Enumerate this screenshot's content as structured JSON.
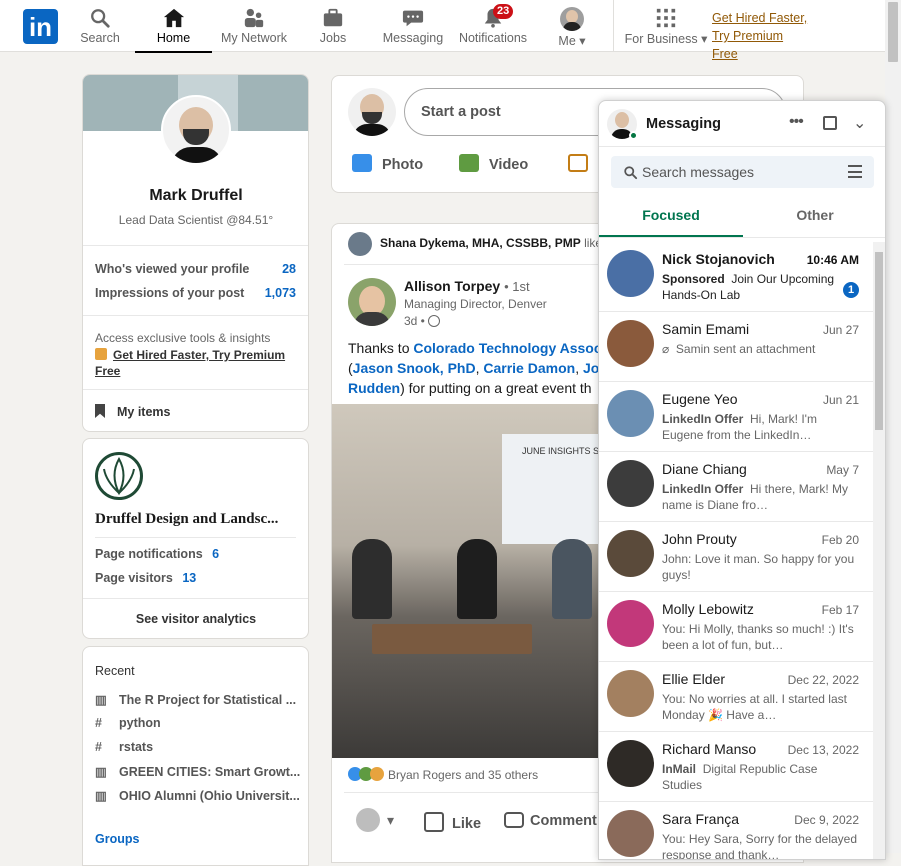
{
  "nav": {
    "logo": "in",
    "items": [
      {
        "label": "Search"
      },
      {
        "label": "Home"
      },
      {
        "label": "My Network"
      },
      {
        "label": "Jobs"
      },
      {
        "label": "Messaging"
      },
      {
        "label": "Notifications",
        "badge": "23"
      },
      {
        "label": "Me"
      },
      {
        "label": "For Business"
      }
    ],
    "premium_line1": "Get Hired Faster,",
    "premium_line2": "Try Premium Free"
  },
  "profile": {
    "name": "Mark Druffel",
    "headline": "Lead Data Scientist @84.51°",
    "stats": [
      {
        "label": "Who's viewed your profile",
        "value": "28"
      },
      {
        "label": "Impressions of your post",
        "value": "1,073"
      }
    ],
    "premium_text": "Access exclusive tools & insights",
    "premium_link": "Get Hired Faster, Try Premium Free",
    "my_items": "My items"
  },
  "company": {
    "name": "Druffel Design and Landsc...",
    "stats": [
      {
        "label": "Page notifications",
        "value": "6"
      },
      {
        "label": "Page visitors",
        "value": "13"
      }
    ],
    "analytics": "See visitor analytics"
  },
  "recent": {
    "title": "Recent",
    "items": [
      {
        "icon": "group-icon",
        "label": "The R Project for Statistical ..."
      },
      {
        "icon": "hashtag-icon",
        "label": "python"
      },
      {
        "icon": "hashtag-icon",
        "label": "rstats"
      },
      {
        "icon": "group-icon",
        "label": "GREEN CITIES: Smart Growt..."
      },
      {
        "icon": "group-icon",
        "label": "OHIO Alumni (Ohio Universit..."
      }
    ],
    "groups": "Groups"
  },
  "share": {
    "placeholder": "Start a post",
    "actions": [
      "Photo",
      "Video"
    ]
  },
  "post": {
    "liked_by": "Shana Dykema, MHA, CSSBB, PMP",
    "liked_suffix": "likes",
    "author": "Allison Torpey",
    "degree": "• 1st",
    "author_title": "Managing Director, Denver",
    "time": "3d •",
    "text_prefix": "Thanks to ",
    "text_link1": "Colorado Technology Associ",
    "text_open": "(",
    "text_link2": "Jason Snook, PhD",
    "text_sep1": ", ",
    "text_link3": "Carrie Damon",
    "text_sep2": ", ",
    "text_link4": "Jon",
    "text_link5": "Rudden",
    "text_suffix": ") for putting on a great event th",
    "screen_title": "JUNE INSIGHTS S",
    "reactions": "Bryan Rogers and 35 others",
    "buttons": {
      "like": "Like",
      "comment": "Comment"
    }
  },
  "messaging": {
    "title": "Messaging",
    "search_placeholder": "Search messages",
    "tabs": [
      "Focused",
      "Other"
    ],
    "conversations": [
      {
        "name": "Nick Stojanovich",
        "date": "10:46 AM",
        "tag": "Sponsored",
        "preview": "Join Our Upcoming Hands-On Lab",
        "unread": "1",
        "bold": true,
        "color": "#4a6fa5"
      },
      {
        "name": "Samin Emami",
        "date": "Jun 27",
        "tag": "",
        "preview": "Samin sent an attachment",
        "color": "#8a5a3c"
      },
      {
        "name": "Eugene Yeo",
        "date": "Jun 21",
        "tag": "LinkedIn Offer",
        "preview": "Hi, Mark! I'm Eugene from the LinkedIn…",
        "color": "#6b8fb3"
      },
      {
        "name": "Diane Chiang",
        "date": "May 7",
        "tag": "LinkedIn Offer",
        "preview": "Hi there, Mark! My name is Diane fro…",
        "color": "#3c3c3c"
      },
      {
        "name": "John Prouty",
        "date": "Feb 20",
        "tag": "",
        "preview": "John: Love it man. So happy for you guys!",
        "color": "#5a4a3a"
      },
      {
        "name": "Molly Lebowitz",
        "date": "Feb 17",
        "tag": "",
        "preview": "You: Hi Molly, thanks so much! :)  It's been a lot of fun, but…",
        "color": "#c2387a"
      },
      {
        "name": "Ellie Elder",
        "date": "Dec 22, 2022",
        "tag": "",
        "preview": "You: No worries at all. I started last Monday 🎉 Have a…",
        "color": "#a38060"
      },
      {
        "name": "Richard Manso",
        "date": "Dec 13, 2022",
        "tag": "InMail",
        "preview": "Digital Republic Case Studies",
        "color": "#2e2a26"
      },
      {
        "name": "Sara França",
        "date": "Dec 9, 2022",
        "tag": "",
        "preview": "You: Hey Sara, Sorry for the delayed response and thank…",
        "color": "#8a6a5a"
      }
    ]
  }
}
